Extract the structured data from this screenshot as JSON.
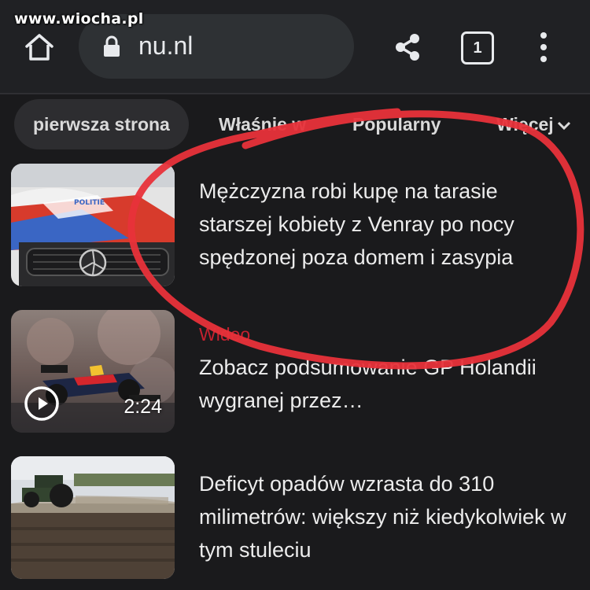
{
  "watermark": "www.wiocha.pl",
  "browser": {
    "url": "nu.nl",
    "tab_count": "1"
  },
  "icons": {
    "home": "home-icon",
    "lock": "lock-icon",
    "share": "share-icon",
    "tabs": "tab-switcher-icon",
    "menu": "more-vert-icon",
    "play": "play-icon",
    "chevron": "chevron-down-icon"
  },
  "nav": {
    "tabs": [
      {
        "label": "pierwsza strona",
        "active": true
      },
      {
        "label": "Właśnie w"
      },
      {
        "label": "Popularny"
      },
      {
        "label": "Więcej"
      }
    ]
  },
  "articles": [
    {
      "category": "",
      "headline": "Mężczyzna robi kupę na tarasie starszej kobiety z Venray po nocy spędzonej poza domem i zasypia",
      "thumb_text": "POLITIE"
    },
    {
      "category": "Wideo",
      "headline": "Zobacz podsumowanie GP Holandii wygranej przez…",
      "duration": "2:24"
    },
    {
      "category": "",
      "headline": "Deficyt opadów wzrasta do 310 milimetrów: większy niż kiedykolwiek w tym stuleciu"
    }
  ],
  "colors": {
    "background": "#1a1a1c",
    "toolbar": "#202124",
    "url_pill": "#2e3134",
    "category_red": "#c4212f",
    "annotation_red": "#e8323a"
  }
}
